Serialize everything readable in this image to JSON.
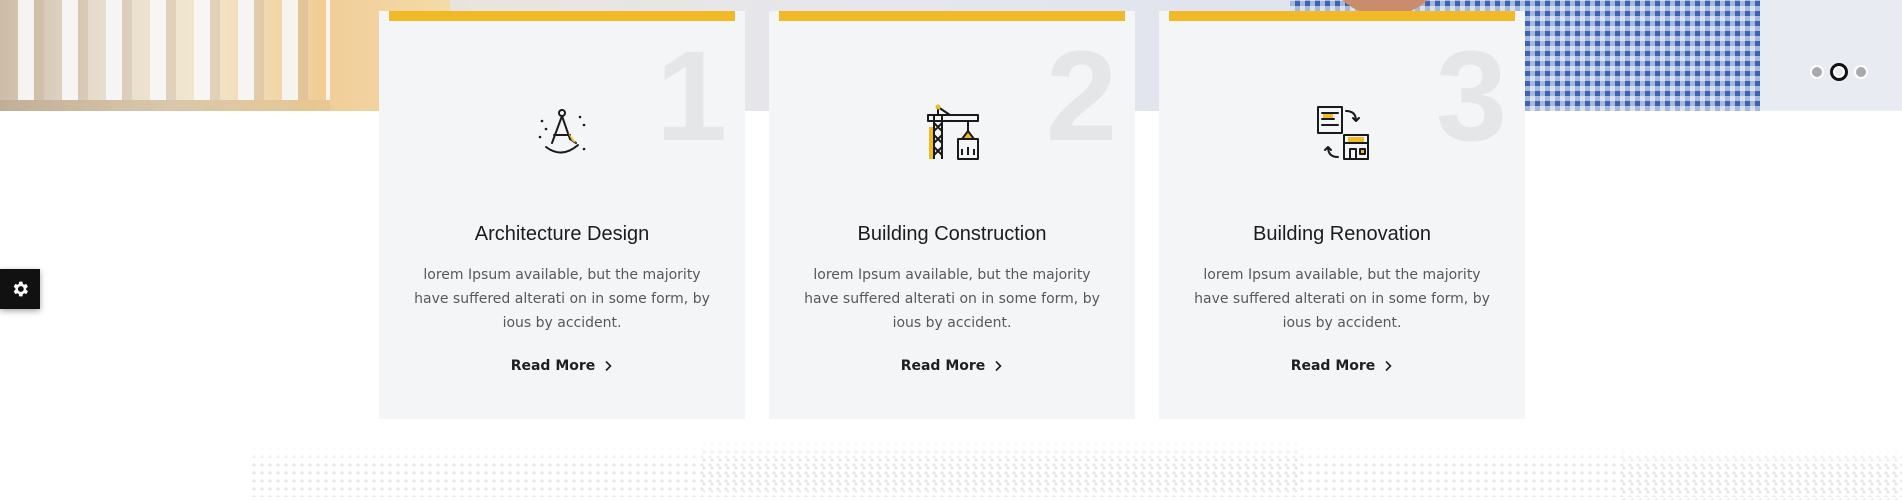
{
  "hero": {
    "slider_dots": [
      {
        "active": false
      },
      {
        "active": true
      },
      {
        "active": false
      }
    ]
  },
  "settings": {
    "icon": "gear-icon"
  },
  "colors": {
    "accent": "#f2b926",
    "card_bg": "#f4f5f7",
    "number": "#e5e6e8",
    "heading": "#1c1c1c",
    "body_text": "#55585d"
  },
  "services": [
    {
      "number": "1",
      "icon": "drafting-compass-icon",
      "title": "Architecture Design",
      "description": "lorem Ipsum available, but the majority have suffered alterati on in some form, by ious by accident.",
      "link_label": "Read More"
    },
    {
      "number": "2",
      "icon": "crane-building-icon",
      "title": "Building Construction",
      "description": "lorem Ipsum available, but the majority have suffered alterati on in some form, by ious by accident.",
      "link_label": "Read More"
    },
    {
      "number": "3",
      "icon": "renovation-blueprint-icon",
      "title": "Building Renovation",
      "description": "lorem Ipsum available, but the majority have suffered alterati on in some form, by ious by accident.",
      "link_label": "Read More"
    }
  ]
}
